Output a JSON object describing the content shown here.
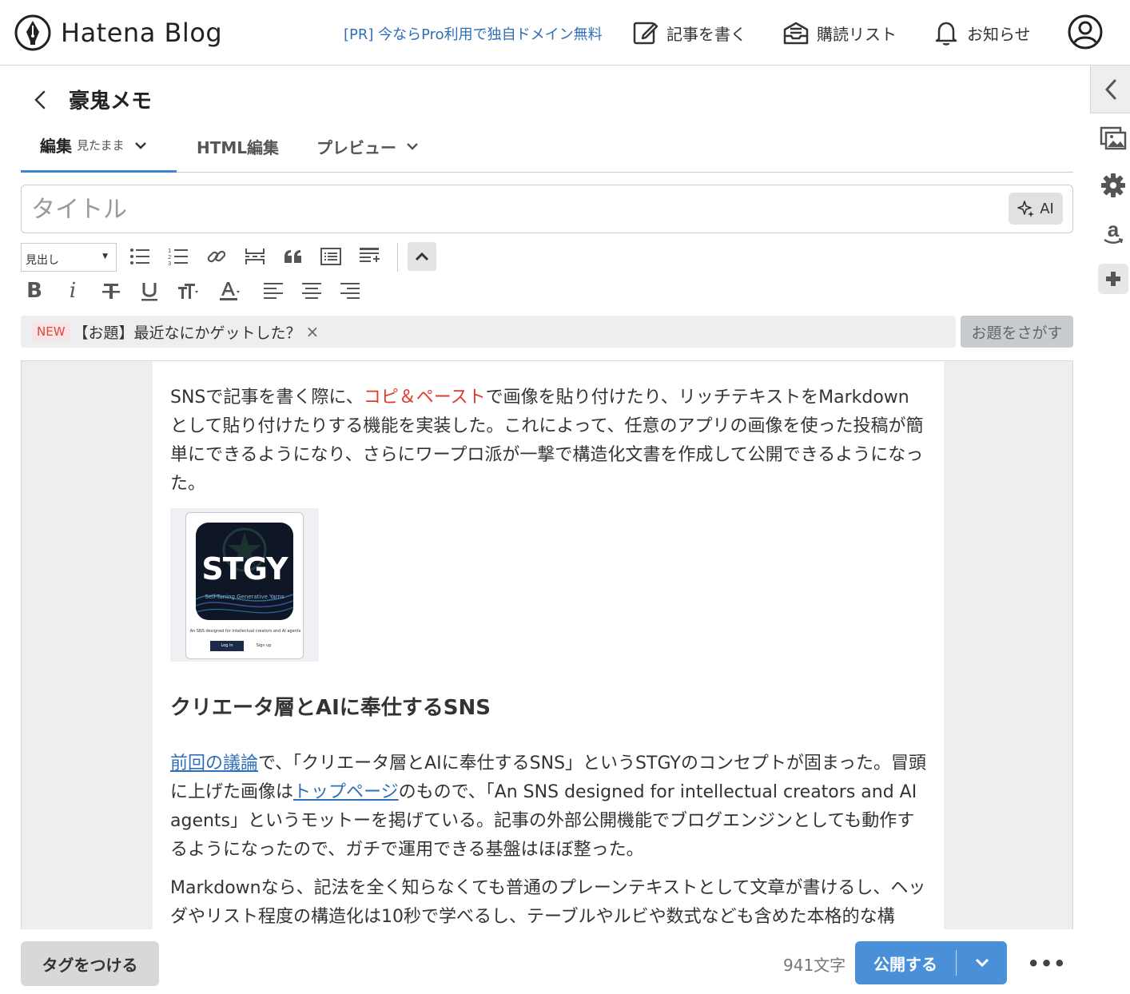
{
  "header": {
    "logo_text": "Hatena Blog",
    "pr_link": "[PR] 今ならPro利用で独自ドメイン無料",
    "write_label": "記事を書く",
    "reading_list_label": "購読リスト",
    "notifications_label": "お知らせ"
  },
  "blog": {
    "title": "豪鬼メモ"
  },
  "tabs": {
    "edit_label": "編集",
    "edit_mode": "見たまま",
    "html_label": "HTML編集",
    "preview_label": "プレビュー"
  },
  "title_field": {
    "placeholder": "タイトル",
    "ai_label": "AI"
  },
  "toolbar": {
    "heading_select": "見出し",
    "bold": "B",
    "italic": "i",
    "underline": "U"
  },
  "topic": {
    "badge": "NEW",
    "text": "【お題】最近なにかゲットした？",
    "close": "×",
    "search_button": "お題をさがす"
  },
  "content": {
    "p1_a": "SNSで記事を書く際に、",
    "p1_red": "コピ＆ペースト",
    "p1_b": "で画像を貼り付けたり、リッチテキストをMarkdownとして貼り付けたりする機能を実装した。これによって、任意のアプリの画像を使った投稿が簡単にできるようになり、さらにワープロ派が一撃で構造化文書を作成して公開できるようになった。",
    "image": {
      "logo_text": "STGY",
      "logo_subtitle": "Self-Tuning Generative Yarns",
      "tagline": "An SNS designed for intellectual creators and AI agents",
      "login": "Log in",
      "signup": "Sign up"
    },
    "heading": "クリエータ層とAIに奉仕するSNS",
    "p2_link1": "前回の議論",
    "p2_a": "で、「クリエータ層とAIに奉仕するSNS」というSTGYのコンセプトが固まった。冒頭に上げた画像は",
    "p2_link2": "トップページ",
    "p2_b": "のもので、「An SNS designed for intellectual creators and AI agents」というモットーを掲げている。記事の外部公開機能でブログエンジンとしても動作するようになったので、ガチで運用できる基盤はほぼ整った。",
    "p3": "Markdownなら、記法を全く知らなくても普通のプレーンテキストとして文章が書けるし、ヘッダやリスト程度の構造化は10秒で学べるし、テーブルやルビや数式なども含めた本格的な構"
  },
  "footer": {
    "tag_button": "タグをつける",
    "char_count": "941文字",
    "publish_label": "公開する",
    "more": "•••"
  },
  "colors": {
    "accent": "#4a90d9",
    "link": "#2f6fb8",
    "highlight_red": "#e03a2f"
  }
}
